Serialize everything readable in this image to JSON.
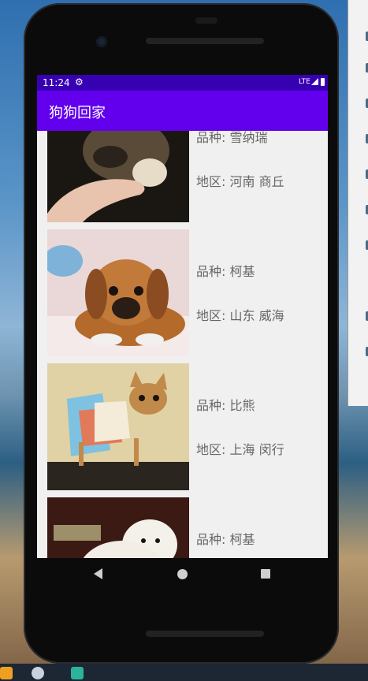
{
  "status_bar": {
    "time": "11:24",
    "network": "LTE"
  },
  "app_bar": {
    "title": "狗狗回家"
  },
  "dogs": [
    {
      "breed_label": "品种: 雪纳瑞",
      "region_label": "地区: 河南 商丘"
    },
    {
      "breed_label": "品种: 柯基",
      "region_label": "地区: 山东 威海"
    },
    {
      "breed_label": "品种: 比熊",
      "region_label": "地区: 上海 闵行"
    },
    {
      "breed_label": "品种: 柯基",
      "region_label": ""
    }
  ],
  "colors": {
    "status_bar": "#3700b3",
    "app_bar": "#6200ee",
    "list_bg": "#f0f0f0",
    "label_text": "#666666"
  },
  "icons": {
    "status": [
      "gear-icon",
      "signal-icon",
      "battery-icon"
    ],
    "nav": [
      "back-icon",
      "home-icon",
      "recents-icon"
    ]
  }
}
